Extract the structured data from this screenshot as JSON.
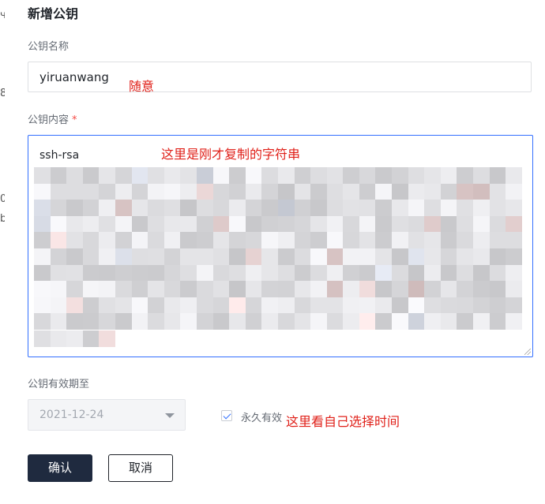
{
  "edge_fragments": [
    "ч",
    "8",
    "0",
    "b"
  ],
  "dialog": {
    "title": "新增公钥"
  },
  "key_name": {
    "label": "公钥名称",
    "value": "yiruanwang",
    "annotation": "随意"
  },
  "key_content": {
    "label": "公钥内容",
    "required_mark": "*",
    "first_line": "ssh-rsa",
    "annotation": "这里是刚才复制的字符串",
    "redacted": true
  },
  "expiry": {
    "label": "公钥有效期至",
    "date_value": "2021-12-24",
    "date_disabled": true,
    "permanent_label": "永久有效",
    "permanent_checked": true,
    "annotation": "这里看自己选择时间"
  },
  "actions": {
    "confirm_label": "确认",
    "cancel_label": "取消"
  },
  "colors": {
    "primary_button": "#1f2a3f",
    "focus_border": "#3370ff",
    "annotation_text": "#e0211a",
    "required_star": "#f54a45"
  }
}
